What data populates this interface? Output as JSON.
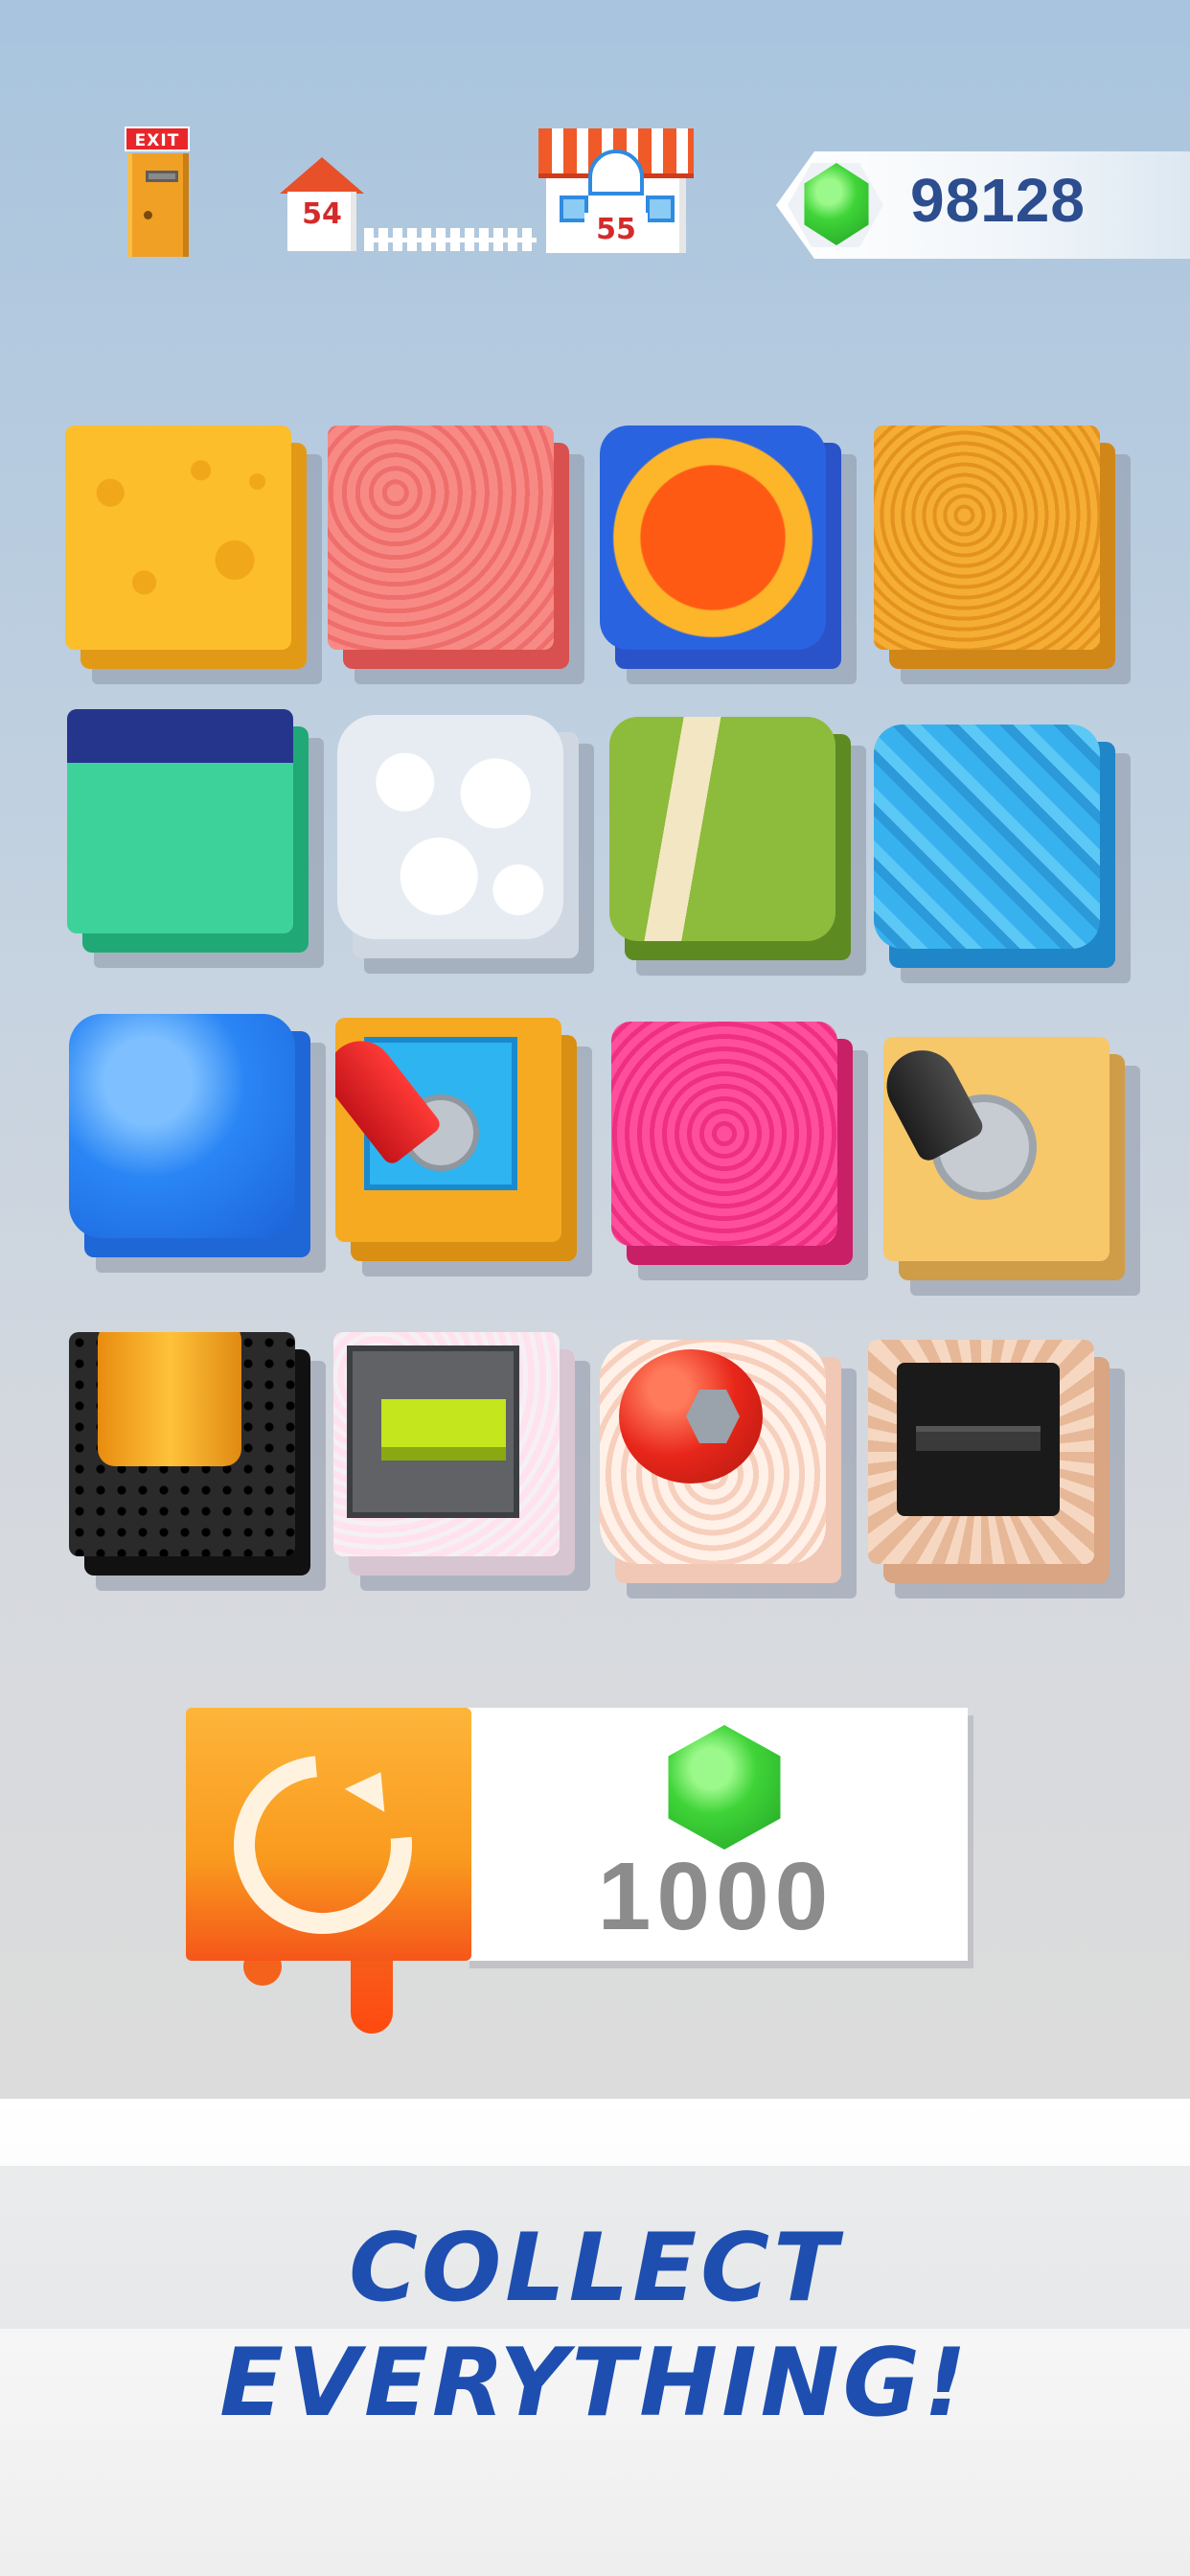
{
  "hud": {
    "exit_label": "EXIT",
    "current_level": "54",
    "next_level": "55",
    "gem_count": "98128"
  },
  "collection": [
    {
      "name": "cheese-sponge"
    },
    {
      "name": "pink-fluffy"
    },
    {
      "name": "pompom"
    },
    {
      "name": "orange-sponge"
    },
    {
      "name": "green-sponge"
    },
    {
      "name": "bubbles"
    },
    {
      "name": "strap-sponge"
    },
    {
      "name": "blue-ribbon"
    },
    {
      "name": "blue-jelly"
    },
    {
      "name": "red-joystick"
    },
    {
      "name": "pink-berry"
    },
    {
      "name": "black-joystick"
    },
    {
      "name": "orange-knob"
    },
    {
      "name": "lime-lever"
    },
    {
      "name": "red-ball-nut"
    },
    {
      "name": "black-switch"
    }
  ],
  "reward": {
    "price": "1000",
    "refresh_icon": "refresh-icon",
    "currency_icon": "gem-icon"
  },
  "banner": {
    "line1": "COLLECT",
    "line2": "EVERYTHING!"
  },
  "colors": {
    "headline": "#1e4fb0",
    "gem": "#3fd438",
    "counter_text": "#2c4d8e"
  }
}
